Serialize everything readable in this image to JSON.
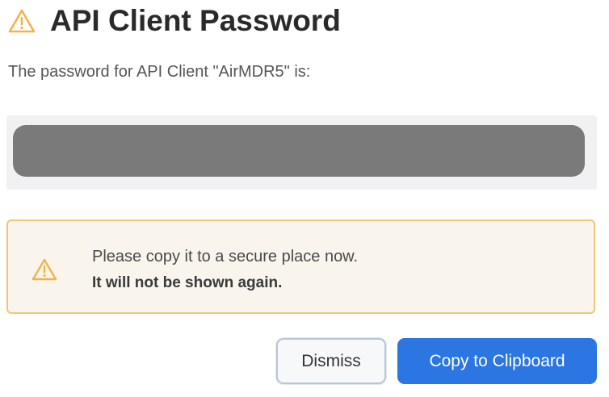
{
  "dialog": {
    "title": "API Client Password",
    "title_icon": "warning-triangle-icon",
    "description": "The password for API Client \"AirMDR5\" is:",
    "password": {
      "masked": true,
      "value": ""
    },
    "warning": {
      "icon": "warning-triangle-icon",
      "line1": "Please copy it to a secure place now.",
      "line2": "It will not be shown again."
    },
    "buttons": {
      "dismiss_label": "Dismiss",
      "copy_label": "Copy to Clipboard"
    }
  },
  "colors": {
    "warning_accent": "#f0b54a",
    "warning_background": "#f9f4ec",
    "primary_button": "#2b76e2",
    "masked_field": "#7a7a7a"
  }
}
